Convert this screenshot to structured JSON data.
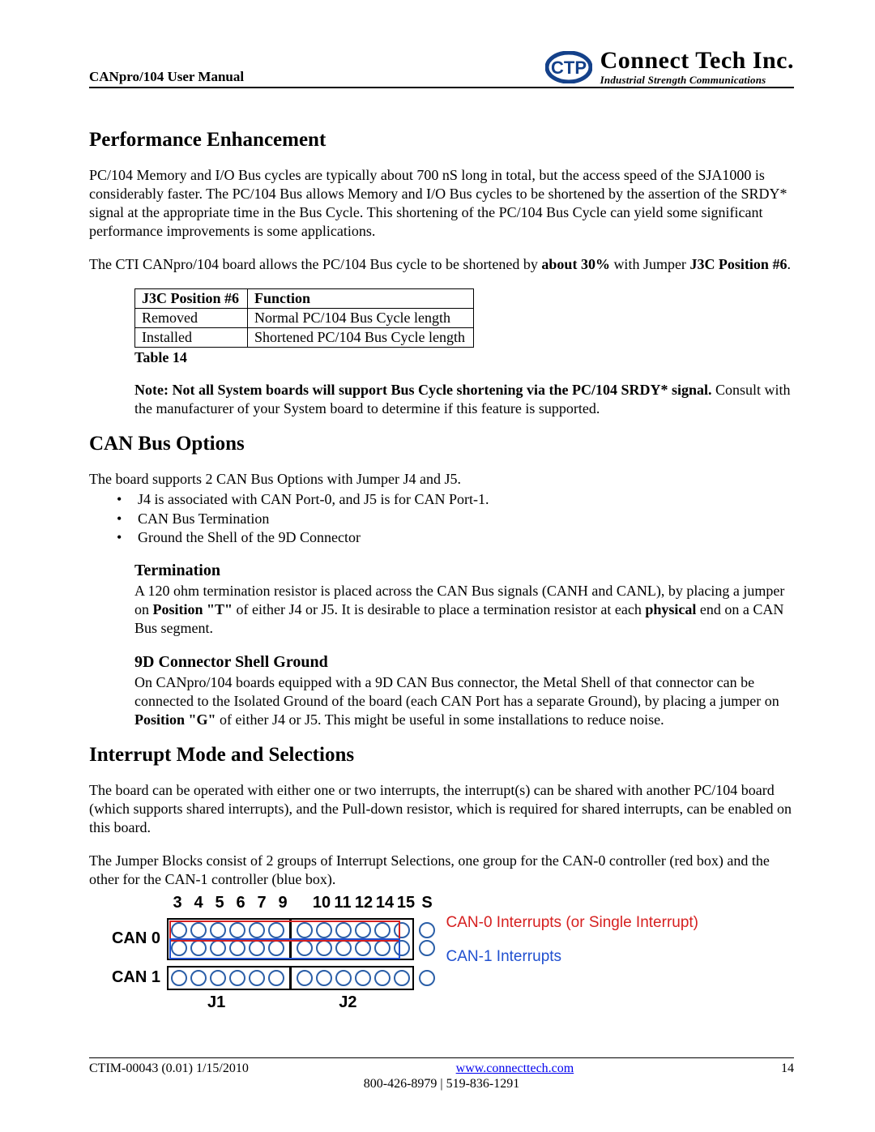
{
  "header": {
    "doc_title": "CANpro/104 User Manual",
    "company_name": "Connect Tech Inc.",
    "company_tagline": "Industrial Strength Communications"
  },
  "sec_perf": {
    "heading": "Performance Enhancement",
    "para1": "PC/104 Memory and I/O Bus cycles are typically about 700 nS long in total, but the access speed of the SJA1000 is considerably faster. The PC/104 Bus allows Memory and I/O Bus cycles to be shortened by the assertion of the SRDY* signal at the appropriate time in the Bus Cycle. This shortening of the PC/104 Bus Cycle can yield some significant performance improvements is some applications.",
    "para2_a": "The CTI CANpro/104 board allows the PC/104 Bus cycle to be shortened by ",
    "para2_b": "about 30%",
    "para2_c": " with Jumper ",
    "para2_d": "J3C Position #6",
    "para2_e": ".",
    "table": {
      "h1": "J3C Position #6",
      "h2": "Function",
      "r1c1": "Removed",
      "r1c2": "Normal PC/104 Bus Cycle length",
      "r2c1": "Installed",
      "r2c2": "Shortened PC/104 Bus Cycle length",
      "caption": "Table 14"
    },
    "note_a": "Note: Not all System boards will support Bus Cycle shortening via the PC/104 SRDY* signal.",
    "note_b": " Consult with the manufacturer of your System board to determine if this feature is supported."
  },
  "sec_can": {
    "heading": "CAN Bus Options",
    "intro": "The board supports 2 CAN Bus Options with Jumper J4 and J5.",
    "bullets": [
      "J4 is associated with CAN Port-0, and J5 is for CAN Port-1.",
      "CAN Bus Termination",
      "Ground the Shell of the 9D Connector"
    ],
    "termination": {
      "heading": "Termination",
      "text_a": "A 120 ohm termination resistor is placed across the CAN Bus signals (CANH and CANL), by placing a jumper on ",
      "text_b": "Position \"T\"",
      "text_c": " of either J4 or J5. It is desirable to place a termination resistor at each ",
      "text_d": "physical",
      "text_e": " end on a CAN Bus segment."
    },
    "shell": {
      "heading": "9D Connector Shell Ground",
      "text_a": "On CANpro/104 boards equipped with a 9D CAN Bus connector, the Metal Shell of that connector can be connected to the Isolated Ground of the board (each CAN Port has a separate Ground), by placing a jumper on ",
      "text_b": "Position \"G\"",
      "text_c": " of either J4 or J5. This might be useful in some installations to reduce noise."
    }
  },
  "sec_irq": {
    "heading": "Interrupt Mode and Selections",
    "para1": "The board can be operated with either one or two interrupts, the interrupt(s) can be shared with another PC/104 board (which supports shared interrupts), and the Pull-down resistor, which is required for shared interrupts, can be enabled on this board.",
    "para2": "The Jumper Blocks consist of 2 groups of Interrupt Selections, one group for the CAN-0 controller (red box) and the other for the CAN-1 controller (blue box).",
    "diagram": {
      "top_labels_left": [
        "3",
        "4",
        "5",
        "6",
        "7",
        "9"
      ],
      "top_labels_right": [
        "10",
        "11",
        "12",
        "14",
        "15",
        "S"
      ],
      "row_labels": [
        "CAN 0",
        "CAN 1"
      ],
      "bottom_labels": [
        "J1",
        "J2"
      ],
      "legend_red": "CAN-0 Interrupts (or Single Interrupt)",
      "legend_blue": "CAN-1 Interrupts"
    }
  },
  "footer": {
    "left": "CTIM-00043 (0.01) 1/15/2010",
    "link": "www.connecttech.com",
    "page": "14",
    "phones": "800-426-8979 | 519-836-1291"
  },
  "chart_data": {
    "type": "table",
    "title": "J3C Position #6 Jumper Function (Table 14)",
    "columns": [
      "J3C Position #6",
      "Function"
    ],
    "rows": [
      [
        "Removed",
        "Normal PC/104 Bus Cycle length"
      ],
      [
        "Installed",
        "Shortened PC/104 Bus Cycle length"
      ]
    ]
  }
}
